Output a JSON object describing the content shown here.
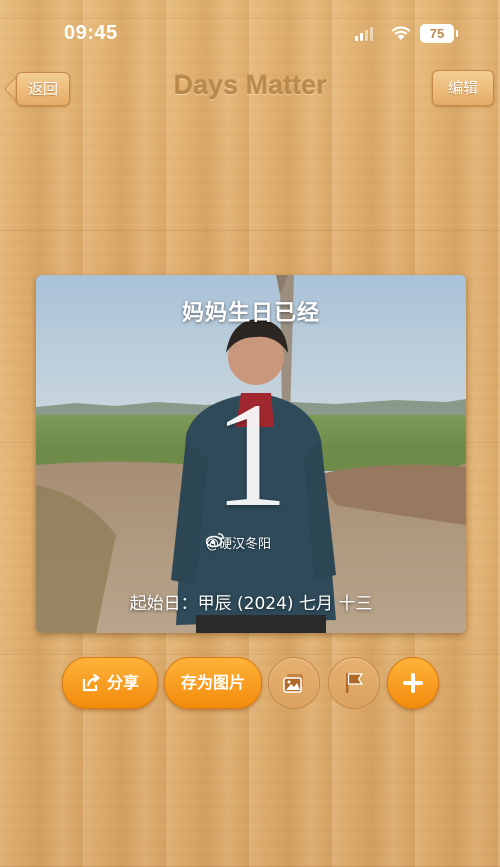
{
  "status": {
    "time": "09:45",
    "battery": "75"
  },
  "nav": {
    "back_label": "返回",
    "title": "Days Matter",
    "edit_label": "编辑"
  },
  "card": {
    "title": "妈妈生日已经",
    "count": "1",
    "watermark": "@硬汉冬阳",
    "start_date": "起始日：甲辰 (2024) 七月 十三"
  },
  "toolbar": {
    "share_label": "分享",
    "save_image_label": "存为图片",
    "icons": [
      "share-icon",
      "image-icon",
      "flag-icon",
      "plus-icon"
    ]
  },
  "colors": {
    "accent_orange": "#f59a1e",
    "wood": "#e2b070",
    "title_brown": "#b98a4b"
  }
}
